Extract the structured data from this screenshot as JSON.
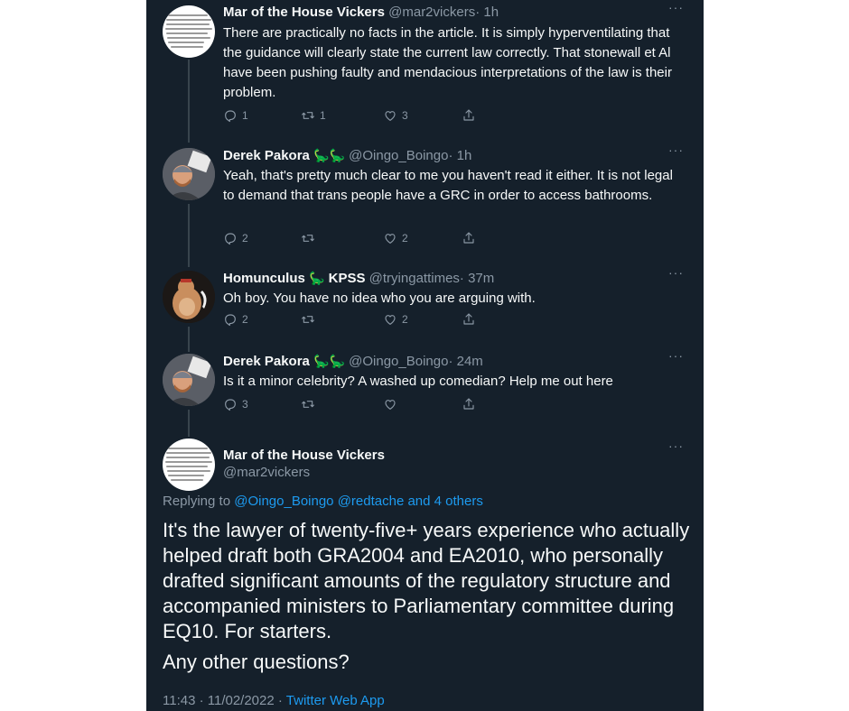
{
  "tweets": [
    {
      "name": "Mar of the House Vickers",
      "handle": "@mar2vickers",
      "time": "· 1h",
      "text": "There are practically no facts in the article. It is simply hyperventilating that the guidance will clearly state the current law correctly. That stonewall et Al have been pushing faulty and mendacious interpretations of the law is their problem.",
      "replies": "1",
      "retweets": "1",
      "likes": "3"
    },
    {
      "name": "Derek Pakora",
      "handle": "@Oingo_Boingo",
      "time": "· 1h",
      "text": "Yeah, that's pretty much clear to me you haven't read it either. It is not legal to demand that trans people have a GRC in order to access bathrooms.",
      "replies": "2",
      "retweets": "",
      "likes": "2"
    },
    {
      "name": "Homunculus",
      "name_suffix": "KPSS",
      "handle": "@tryingattimes",
      "time": "· 37m",
      "text": "Oh boy. You have no idea who you are arguing with.",
      "replies": "2",
      "retweets": "",
      "likes": "2"
    },
    {
      "name": "Derek Pakora",
      "handle": "@Oingo_Boingo",
      "time": "· 24m",
      "text": "Is it a minor celebrity? A washed up comedian? Help me out here",
      "replies": "3",
      "retweets": "",
      "likes": ""
    }
  ],
  "main_tweet": {
    "name": "Mar of the House Vickers",
    "handle": "@mar2vickers",
    "replying_prefix": "Replying to ",
    "replying_to": "@Oingo_Boingo @redtache and 4 others",
    "text": "It's the lawyer of twenty-five+ years experience who actually helped draft both GRA2004 and EA2010, who personally drafted significant amounts of the regulatory structure and accompanied ministers to Parliamentary committee during EQ10. For starters.",
    "text2": "Any other questions?",
    "timestamp": "11:43 · 11/02/2022 · ",
    "client": "Twitter Web App"
  },
  "icons": {
    "more": "more-icon",
    "reply": "reply-icon",
    "retweet": "retweet-icon",
    "like": "like-icon",
    "share": "share-icon",
    "dino": "dinosaur-emoji"
  },
  "colors": {
    "background": "#15202b",
    "text": "#f7f9f9",
    "secondary": "#8b98a5",
    "link": "#1d9bf0",
    "thread_line": "#38444d"
  }
}
